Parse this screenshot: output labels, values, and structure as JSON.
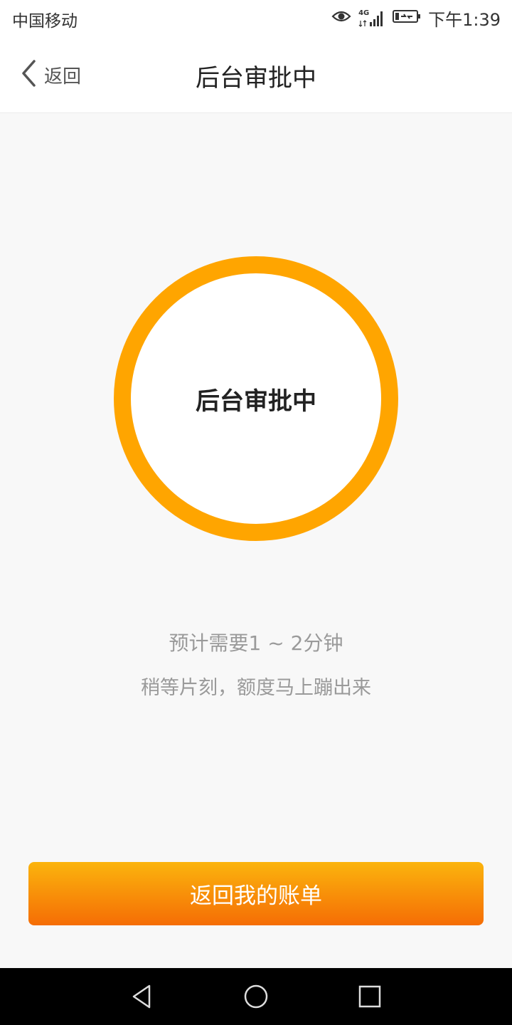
{
  "status_bar": {
    "carrier": "中国移动",
    "network": "4G",
    "time": "下午1:39"
  },
  "header": {
    "back_label": "返回",
    "title": "后台审批中"
  },
  "status_circle": {
    "text": "后台审批中",
    "ring_color": "#ffa500"
  },
  "info": {
    "line1": "预计需要1 ~ 2分钟",
    "line2": "稍等片刻，额度马上蹦出来"
  },
  "primary_button": {
    "label": "返回我的账单",
    "gradient_start": "#fbb40d",
    "gradient_end": "#f56d05"
  },
  "icons": {
    "back": "chevron-left-icon",
    "eye": "eye-icon",
    "signal": "signal-icon",
    "battery": "battery-charging-icon",
    "sys_back": "triangle-back-icon",
    "sys_home": "circle-home-icon",
    "sys_recents": "square-recents-icon"
  }
}
